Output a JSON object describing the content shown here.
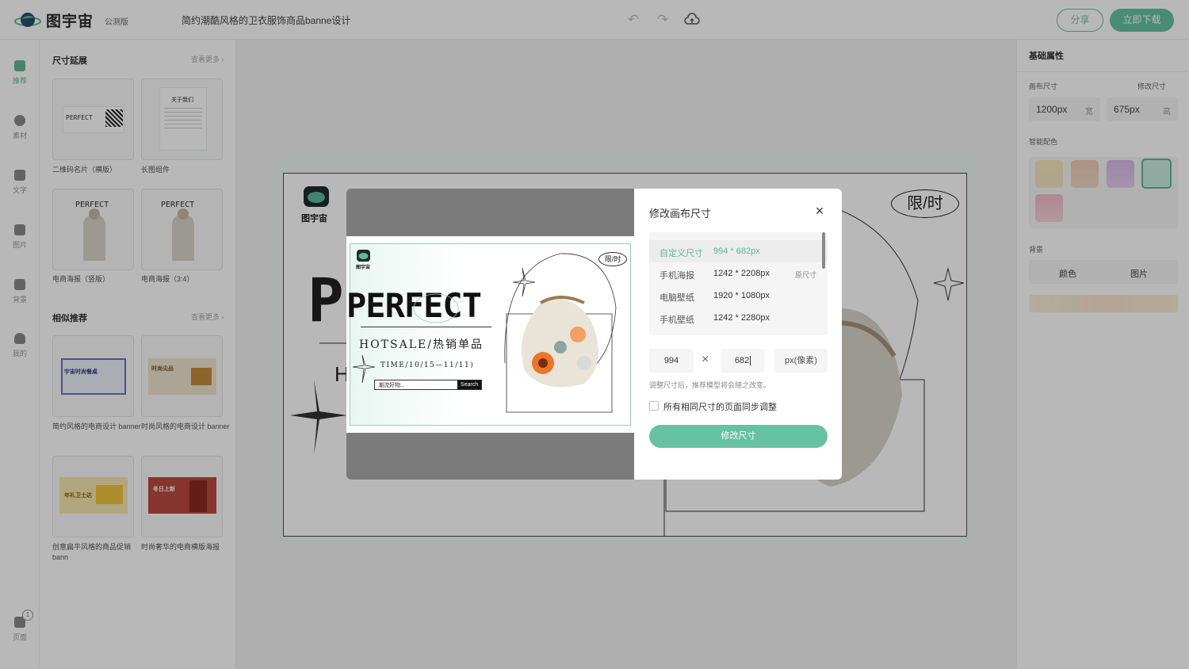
{
  "header": {
    "logo_text": "图宇宙",
    "beta": "公测版",
    "doc_title": "简约潮酷风格的卫衣服饰商品banne设计",
    "share_label": "分享",
    "download_label": "立即下载"
  },
  "rail": {
    "items": [
      {
        "label": "推荐"
      },
      {
        "label": "素材"
      },
      {
        "label": "文字"
      },
      {
        "label": "图片"
      },
      {
        "label": "背景"
      },
      {
        "label": "我的"
      }
    ],
    "pages_label": "页面",
    "pages_count": "1"
  },
  "panel": {
    "section1_title": "尺寸延展",
    "section1_more": "查看更多",
    "section1_items": [
      {
        "caption": "二维码名片（横版）"
      },
      {
        "caption": "长图组件"
      },
      {
        "caption": "电商海报（竖版）"
      },
      {
        "caption": "电商海报（3:4）"
      }
    ],
    "section2_title": "相似推荐",
    "section2_more": "查看更多",
    "section2_items": [
      {
        "caption": "简约风格的电商设计 banner"
      },
      {
        "caption": "时尚风格的电商设计 banner"
      },
      {
        "caption": "创意扁平风格的商品促销 bann"
      },
      {
        "caption": "时尚奢华的电商横版海报"
      }
    ],
    "thumb_text": {
      "perfect": "PERFECT",
      "about": "关于我们",
      "t5": "宇宙时尚餐桌",
      "t6": "时尚尖品",
      "t7": "年礼卫士达",
      "t8": "冬日上新"
    }
  },
  "props": {
    "title": "基础属性",
    "canvas_size_label": "画布尺寸",
    "modify_size_label": "修改尺寸",
    "width_value": "1200px",
    "width_unit": "宽",
    "height_value": "675px",
    "height_unit": "高",
    "smart_color_label": "智能配色",
    "background_label": "背景",
    "bg_color_label": "颜色",
    "bg_image_label": "图片"
  },
  "canvas": {
    "brand": "图宇宙",
    "limited": "限/时",
    "big_title": "PERFECT",
    "letter_h": "H"
  },
  "preview": {
    "brand": "图宇宙",
    "limited": "限/时",
    "title": "PERFECT",
    "subtitle": "HOTSALE/热销单品",
    "time": "TIME/10/15—11/11)",
    "search_placeholder": "潮流好物...",
    "search_button": "Search"
  },
  "dialog": {
    "title": "修改画布尺寸",
    "sizes": [
      {
        "name": "自定义尺寸",
        "dims": "994 * 682px",
        "note": ""
      },
      {
        "name": "手机海报",
        "dims": "1242 * 2208px",
        "note": "原尺寸"
      },
      {
        "name": "电脑壁纸",
        "dims": "1920 * 1080px",
        "note": ""
      },
      {
        "name": "手机壁纸",
        "dims": "1242 * 2280px",
        "note": ""
      }
    ],
    "width_input": "994",
    "height_input": "682",
    "unit": "px(像素)",
    "hint": "调整尺寸后，推荐模型将会随之改变。",
    "sync_label": "所有相同尺寸的页面同步调整",
    "sync_checked": false,
    "apply_label": "修改尺寸"
  },
  "colors": {
    "accent": "#67c1a3",
    "swatches": [
      "#f6e7b5",
      "#f3c9b3",
      "#d9b9ec",
      "#c9ece1",
      "#f3bccb"
    ]
  }
}
